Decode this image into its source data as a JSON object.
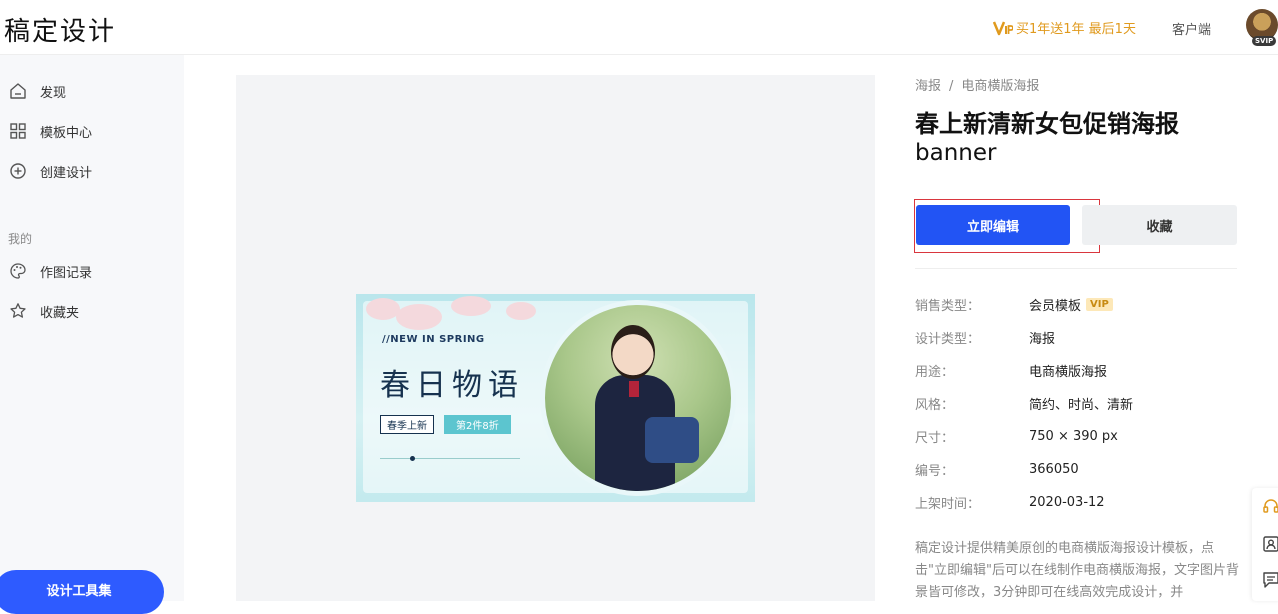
{
  "header": {
    "logo": "稿定设计",
    "promo_text": "买1年送1年 最后1天",
    "client_link": "客户端",
    "svip_badge": "SVIP"
  },
  "sidebar": {
    "items": [
      {
        "label": "发现",
        "icon": "home-icon"
      },
      {
        "label": "模板中心",
        "icon": "grid-icon"
      },
      {
        "label": "创建设计",
        "icon": "plus-circle-icon"
      }
    ],
    "section_label": "我的",
    "my_items": [
      {
        "label": "作图记录",
        "icon": "palette-icon"
      },
      {
        "label": "收藏夹",
        "icon": "star-icon"
      }
    ],
    "tool_button": "设计工具集"
  },
  "preview": {
    "banner_tag": "//NEW IN SPRING",
    "banner_title": "春日物语",
    "banner_pill_1": "春季上新",
    "banner_pill_2": "第2件8折"
  },
  "detail": {
    "breadcrumb": [
      "海报",
      "电商横版海报"
    ],
    "title": "春上新清新女包促销海报",
    "subtitle": "banner",
    "edit_button": "立即编辑",
    "favorite_button": "收藏",
    "attributes": [
      {
        "key": "销售类型：",
        "value": "会员模板",
        "badge": "VIP"
      },
      {
        "key": "设计类型：",
        "value": "海报"
      },
      {
        "key": "用途：",
        "value": "电商横版海报"
      },
      {
        "key": "风格：",
        "value": "简约、时尚、清新"
      },
      {
        "key": "尺寸：",
        "value": "750 × 390 px"
      },
      {
        "key": "编号：",
        "value": "366050"
      },
      {
        "key": "上架时间：",
        "value": "2020-03-12"
      }
    ],
    "description": "稿定设计提供精美原创的电商横版海报设计模板，点击\"立即编辑\"后可以在线制作电商横版海报，文字图片背景皆可修改，3分钟即可在线高效完成设计，并"
  },
  "colors": {
    "primary": "#2254f4",
    "vip": "#e09a1e",
    "focus_outline": "#d9363e"
  },
  "float_bar_icons": [
    "headset-icon",
    "contact-card-icon",
    "message-icon"
  ]
}
